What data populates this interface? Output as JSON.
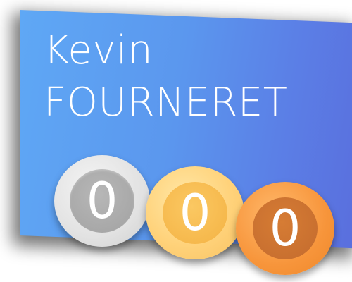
{
  "profile": {
    "first_name": "Kevin",
    "last_name": "FOURNERET"
  },
  "badges": {
    "silver": {
      "count": "0",
      "color": "#a9a9a9",
      "icon": "silver-medal-icon"
    },
    "gold": {
      "count": "0",
      "color": "#f6b94d",
      "icon": "gold-medal-icon"
    },
    "bronze": {
      "count": "0",
      "color": "#c97030",
      "icon": "bronze-medal-icon"
    }
  },
  "colors": {
    "card_start": "#5fa8f5",
    "card_end": "#5a6edd",
    "text": "#ffffff"
  }
}
